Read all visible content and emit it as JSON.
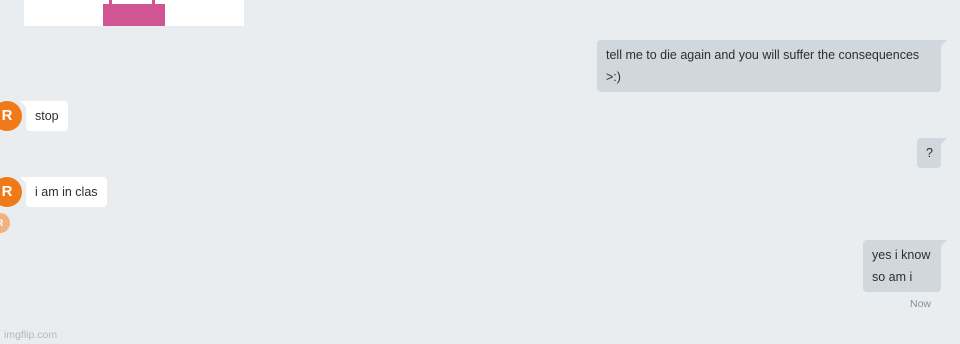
{
  "messages": [
    {
      "direction": "out",
      "lines": [
        "tell me to die again and you will suffer the consequences",
        ">:)"
      ]
    },
    {
      "direction": "in",
      "sender_initial": "R",
      "lines": [
        "stop"
      ]
    },
    {
      "direction": "out",
      "lines": [
        "?"
      ]
    },
    {
      "direction": "in",
      "sender_initial": "R",
      "lines": [
        "i am in clas"
      ]
    },
    {
      "direction": "out",
      "lines": [
        "yes i know",
        "so am i"
      ]
    }
  ],
  "read_receipt_initial": "R",
  "last_timestamp": "Now",
  "watermark": "imgflip.com",
  "colors": {
    "background": "#e9edf0",
    "outgoing_bubble": "#d0d8de",
    "incoming_bubble": "#ffffff",
    "avatar": "#f07a1a",
    "attachment_bag": "#d05592"
  }
}
